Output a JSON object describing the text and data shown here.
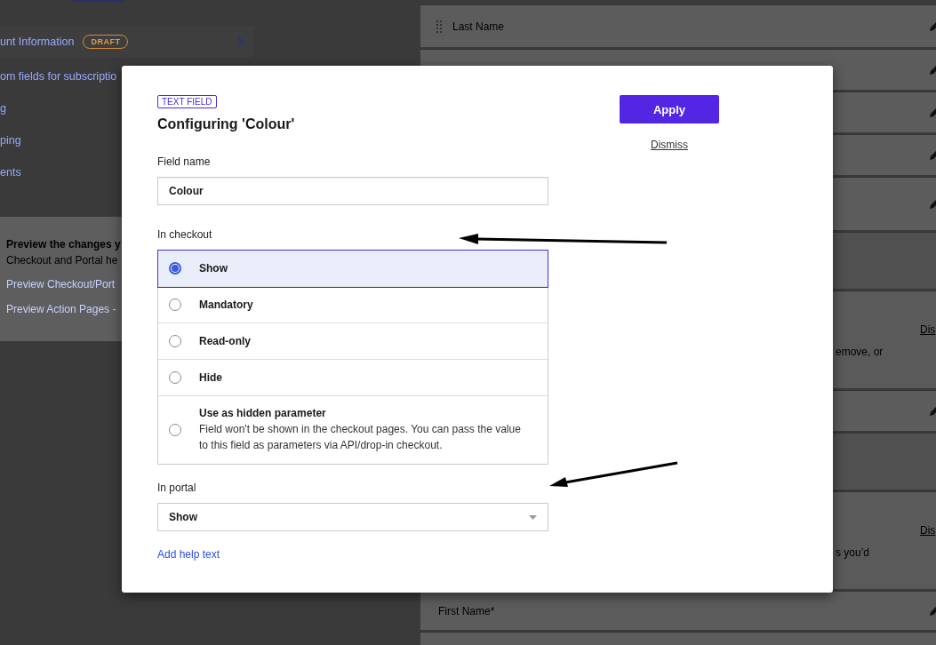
{
  "left_panel": {
    "items": [
      {
        "label": "unt Information",
        "badge": "DRAFT"
      },
      {
        "label": "om fields for subscriptio"
      },
      {
        "label": "g"
      },
      {
        "label": "ping"
      },
      {
        "label": "ents"
      }
    ],
    "preview": {
      "heading": "Preview the changes y",
      "text": "Checkout and Portal he",
      "links": [
        "Preview Checkout/Port",
        "Preview Action Pages -"
      ]
    }
  },
  "right_panel": {
    "rows": [
      {
        "kind": "field",
        "label": "Last Name",
        "handle": true
      },
      {
        "kind": "field"
      },
      {
        "kind": "field"
      },
      {
        "kind": "field"
      },
      {
        "kind": "field"
      },
      {
        "kind": "blank"
      },
      {
        "kind": "section",
        "link": "Dis",
        "text": "emove, or"
      },
      {
        "kind": "field"
      },
      {
        "kind": "blank"
      },
      {
        "kind": "section",
        "link": "Dis",
        "text": "s you’d"
      },
      {
        "kind": "field",
        "label": "First Name*"
      },
      {
        "kind": "stub"
      }
    ]
  },
  "dialog": {
    "tag": "TEXT FIELD",
    "title": "Configuring 'Colour'",
    "apply": "Apply",
    "dismiss": "Dismiss",
    "field_name": {
      "label": "Field name",
      "value": "Colour"
    },
    "in_checkout": {
      "label": "In checkout",
      "options": [
        {
          "label": "Show",
          "selected": true
        },
        {
          "label": "Mandatory",
          "selected": false
        },
        {
          "label": "Read-only",
          "selected": false
        },
        {
          "label": "Hide",
          "selected": false
        },
        {
          "label": "Use as hidden parameter",
          "description": "Field won't be shown in the checkout pages. You can pass the value to this field as parameters via API/drop-in checkout.",
          "selected": false
        }
      ]
    },
    "in_portal": {
      "label": "In portal",
      "value": "Show"
    },
    "help_link": "Add help text"
  }
}
